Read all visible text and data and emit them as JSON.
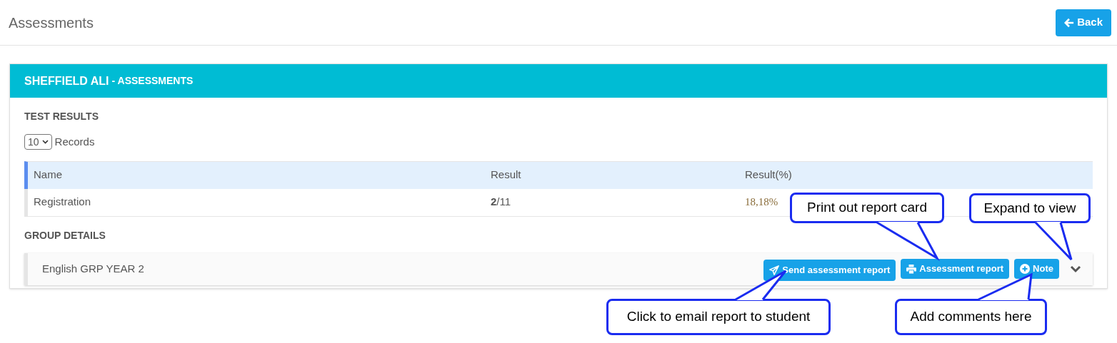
{
  "page": {
    "title": "Assessments",
    "back_button": "Back"
  },
  "card": {
    "title": "SHEFFIELD ALI",
    "subtitle": "- ASSESSMENTS",
    "test_results": {
      "heading": "TEST RESULTS",
      "page_size": "10",
      "page_size_label": "Records",
      "columns": [
        "Name",
        "Result",
        "Result(%)"
      ],
      "rows": [
        {
          "name": "Registration",
          "result": "**2**/11",
          "percent": "18,18%"
        }
      ]
    },
    "group_details": {
      "heading": "GROUP DETAILS",
      "groups": [
        {
          "name": "English GRP YEAR 2",
          "expanded": false,
          "actions": [
            {
              "kind": "send",
              "label": "Send assessment report"
            },
            {
              "kind": "print",
              "label": "Assessment report"
            },
            {
              "kind": "note",
              "label": "Note"
            }
          ]
        }
      ]
    }
  },
  "callouts": [
    "Print out report card",
    "Expand to view",
    "Click to email report to student",
    "Add comments here"
  ]
}
